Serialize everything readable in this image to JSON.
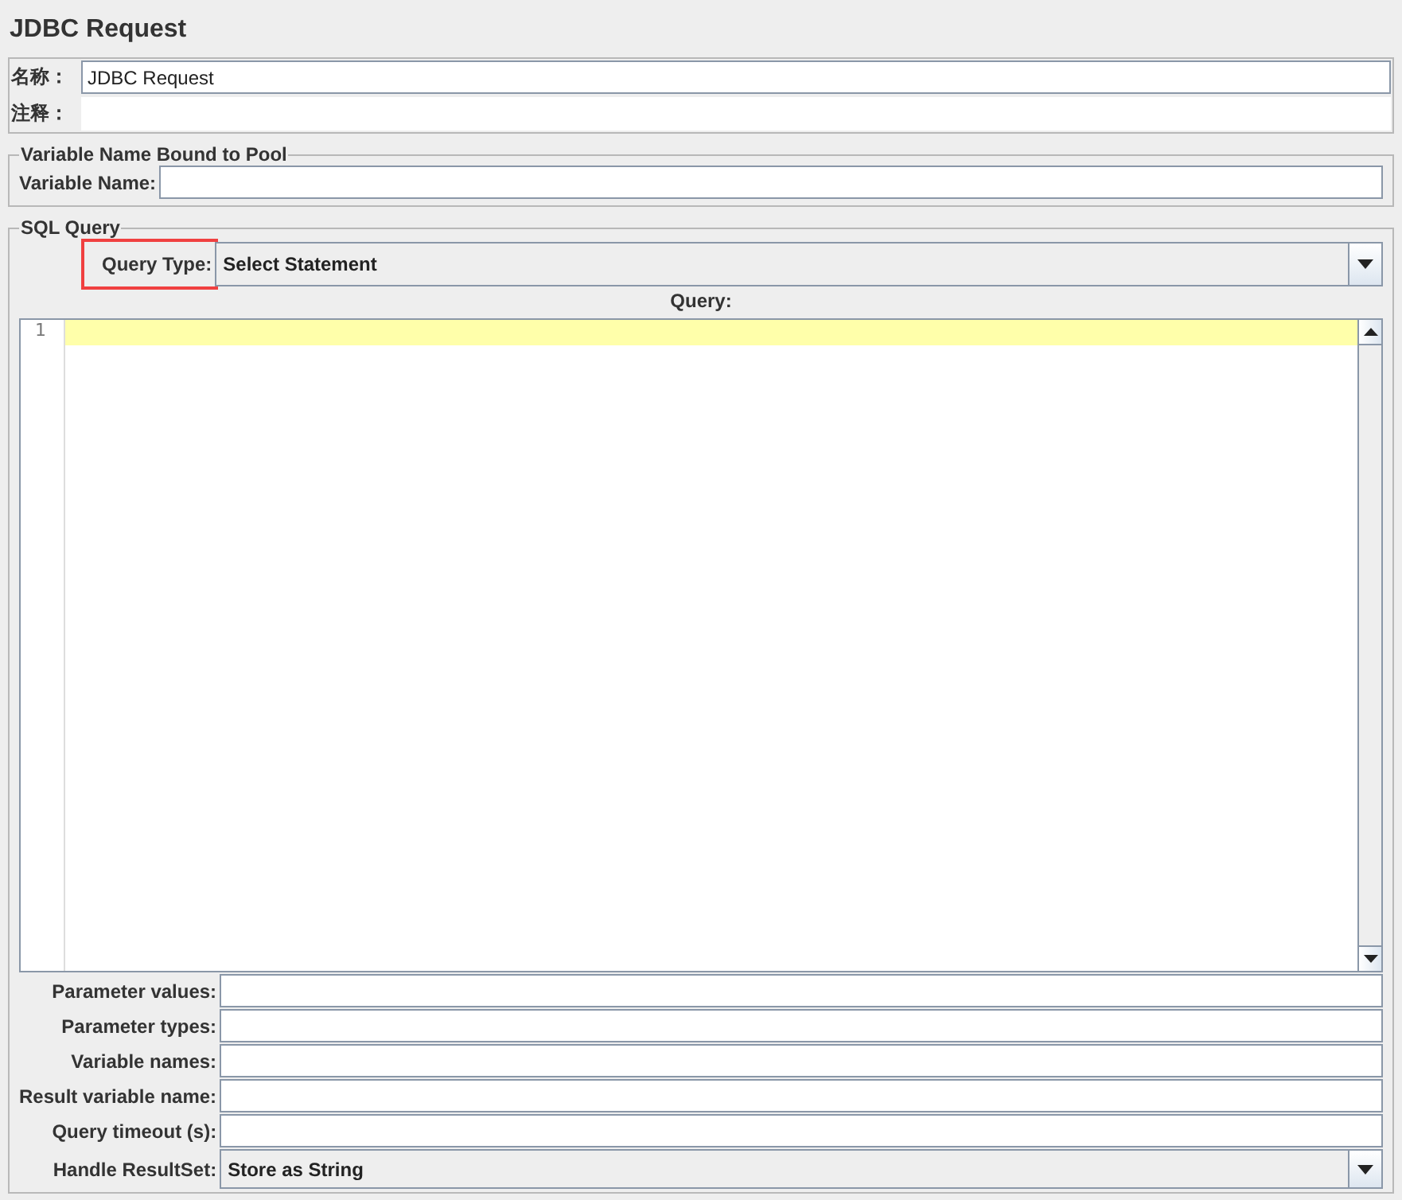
{
  "title": "JDBC Request",
  "name": {
    "label": "名称：",
    "value": "JDBC Request"
  },
  "comment": {
    "label": "注释："
  },
  "pool_section": {
    "legend": "Variable Name Bound to Pool",
    "fields": [
      {
        "label": "Variable Name:"
      }
    ]
  },
  "sql_section": {
    "legend": "SQL Query",
    "query_type": {
      "label": "Query Type:",
      "value": "Select Statement",
      "highlighted": true
    },
    "query_label": "Query:",
    "editor": {
      "line_numbers": [
        "1"
      ]
    },
    "fields": [
      {
        "label": "Parameter values:",
        "kind": "text"
      },
      {
        "label": "Parameter types:",
        "kind": "text"
      },
      {
        "label": "Variable names:",
        "kind": "text"
      },
      {
        "label": "Result variable name:",
        "kind": "text"
      },
      {
        "label": "Query timeout (s):",
        "kind": "text"
      },
      {
        "label": "Handle ResultSet:",
        "kind": "dropdown",
        "value": "Store as String"
      }
    ]
  }
}
